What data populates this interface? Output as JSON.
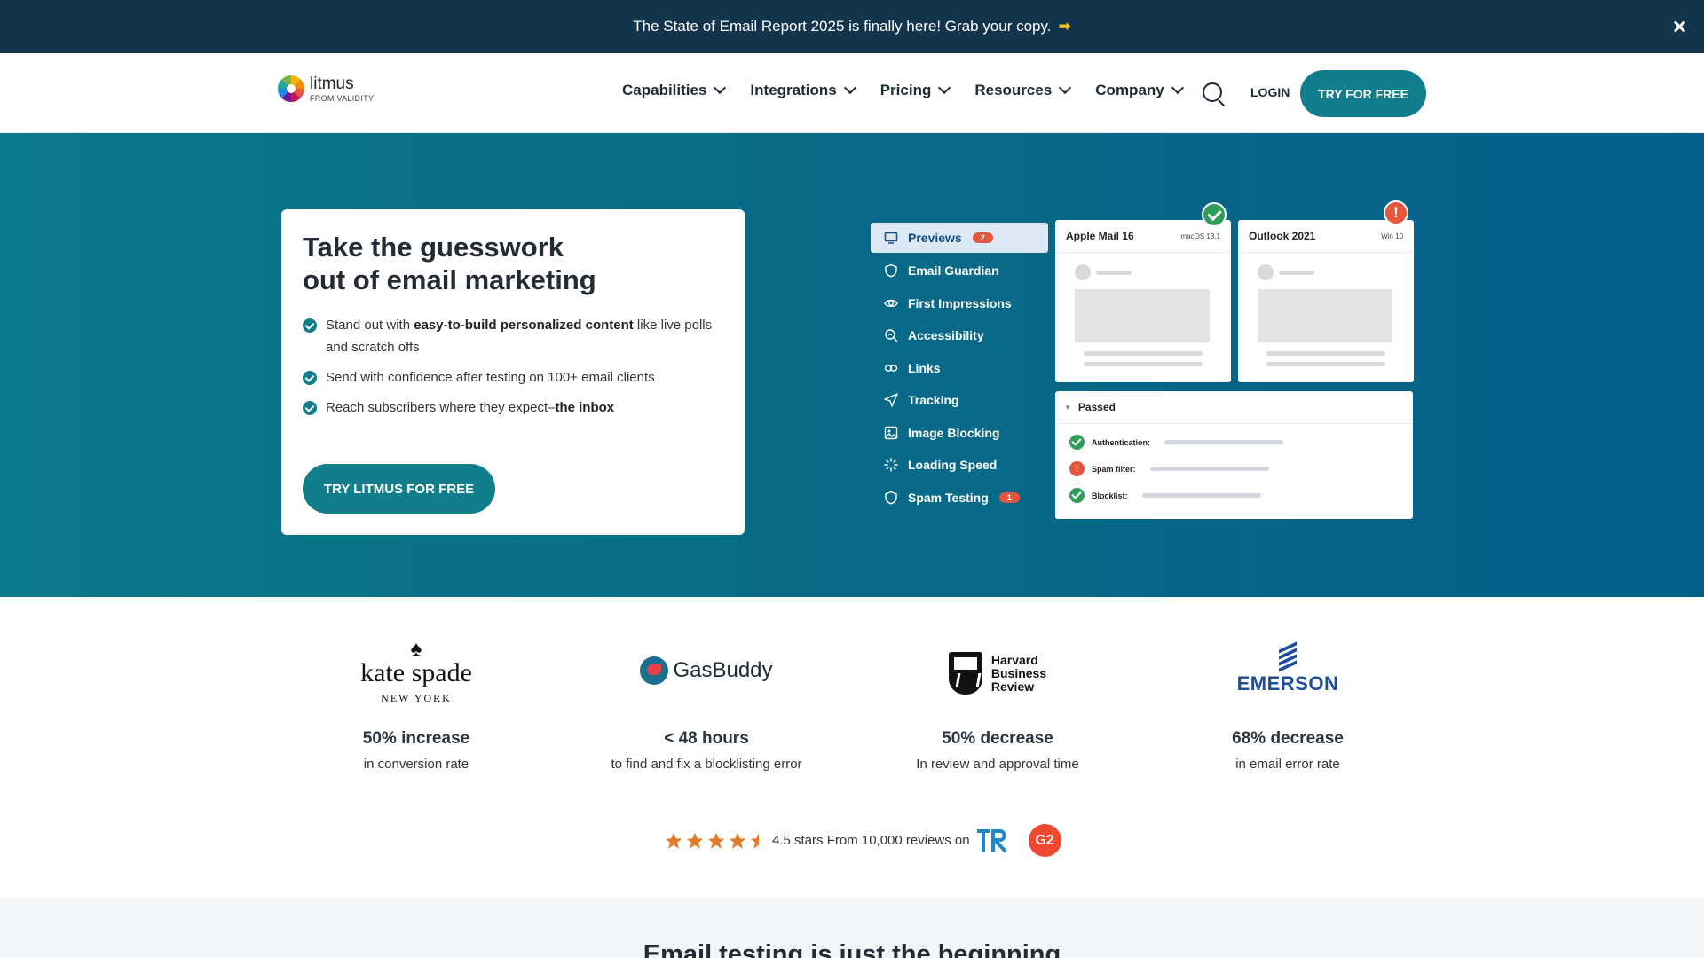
{
  "announcement": {
    "text": "The State of Email Report 2025 is finally here! Grab your copy.",
    "arrow": "➡"
  },
  "logo": {
    "brand": "litmus",
    "sub": "FROM VALIDITY"
  },
  "nav": {
    "items": [
      {
        "label": "Capabilities"
      },
      {
        "label": "Integrations"
      },
      {
        "label": "Pricing"
      },
      {
        "label": "Resources"
      },
      {
        "label": "Company"
      }
    ],
    "login": "LOGIN",
    "cta": "TRY FOR FREE"
  },
  "hero": {
    "title_line1": "Take the guesswork",
    "title_line2": "out of email marketing",
    "bullets": [
      {
        "pre": "Stand out with ",
        "bold": "easy-to-build personalized content",
        "post": " like live polls and scratch offs"
      },
      {
        "pre": "Send with confidence after testing on 100+ email clients",
        "bold": "",
        "post": ""
      },
      {
        "pre": "Reach subscribers where they expect–",
        "bold": "the inbox",
        "post": ""
      }
    ],
    "cta": "TRY LITMUS FOR FREE"
  },
  "mock": {
    "sidebar": [
      {
        "label": "Previews",
        "badge": "2",
        "icon": "monitor-icon",
        "active": true
      },
      {
        "label": "Email Guardian",
        "badge": "",
        "icon": "shield-icon"
      },
      {
        "label": "First Impressions",
        "badge": "",
        "icon": "eye-icon"
      },
      {
        "label": "Accessibility",
        "badge": "",
        "icon": "magnifier-icon"
      },
      {
        "label": "Links",
        "badge": "",
        "icon": "link-icon"
      },
      {
        "label": "Tracking",
        "badge": "",
        "icon": "paper-plane-icon"
      },
      {
        "label": "Image Blocking",
        "badge": "",
        "icon": "image-icon"
      },
      {
        "label": "Loading Speed",
        "badge": "",
        "icon": "spinner-icon"
      },
      {
        "label": "Spam Testing",
        "badge": "1",
        "icon": "shield-icon"
      }
    ],
    "previews": [
      {
        "name": "Apple Mail 16",
        "os": "macOS 13.1",
        "status": "passed"
      },
      {
        "name": "Outlook 2021",
        "os": "Win 10",
        "status": "warning"
      }
    ],
    "checks_header": "Passed",
    "checks": [
      {
        "label": "Authentication:",
        "status": "passed"
      },
      {
        "label": "Spam filter:",
        "status": "failed"
      },
      {
        "label": "Blocklist:",
        "status": "passed"
      }
    ]
  },
  "stats": [
    {
      "brand": "kate spade",
      "brand_sub": "NEW YORK",
      "value": "50% increase",
      "desc": "in conversion rate"
    },
    {
      "brand": "GasBuddy",
      "brand_sub": "",
      "value": "< 48 hours",
      "desc": "to find and fix a blocklisting error"
    },
    {
      "brand": "Harvard Business Review",
      "brand_sub": "",
      "value": "50% decrease",
      "desc": "In review and approval time"
    },
    {
      "brand": "EMERSON",
      "brand_sub": "",
      "value": "68% decrease",
      "desc": "in email error rate"
    }
  ],
  "rating": {
    "stars": 4.5,
    "text": "4.5 stars From 10,000 reviews on",
    "platforms": [
      "trustradius-logo",
      "g2-logo"
    ]
  },
  "section2": {
    "title": "Email testing is just the beginning"
  },
  "colors": {
    "primary": "#117e8c",
    "banner": "#13344d",
    "star": "#e07b2a",
    "warn": "#e4563e",
    "ok": "#2f9e5b"
  }
}
